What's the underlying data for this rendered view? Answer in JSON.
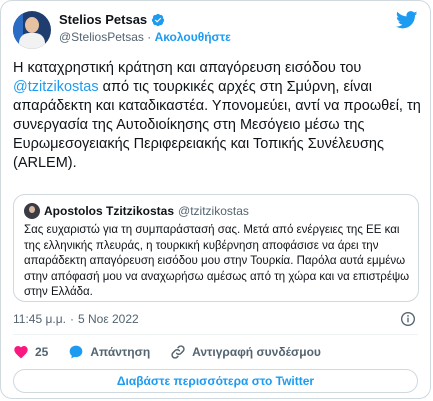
{
  "author": {
    "name": "Stelios Petsas",
    "handle": "@SteliosPetsas",
    "separator": "·",
    "follow_label": "Ακολουθήστε"
  },
  "tweet": {
    "text_before": "Η καταχρηστική κράτηση και απαγόρευση εισόδου του ",
    "mention": "@tzitzikostas",
    "text_after": " από τις τουρκικές αρχές στη Σμύρνη, είναι απαράδεκτη και καταδικαστέα. Υπονομεύει, αντί να προωθεί, τη συνεργασία της Αυτοδιοίκησης στη Μεσόγειο μέσω της Ευρωμεσογειακής Περιφερειακής και Τοπικής Συνέλευσης (ARLEM)."
  },
  "quote": {
    "name": "Apostolos Tzitzikostas",
    "handle": "@tzitzikostas",
    "text": "Σας ευχαριστώ για τη συμπαράστασή σας. Μετά από ενέργειες της ΕΕ και της ελληνικής πλευράς, η τουρκική κυβέρνηση αποφάσισε να άρει την απαράδεκτη απαγόρευση εισόδου μου στην Τουρκία. Παρόλα αυτά εμμένω στην απόφασή μου να αναχωρήσω αμέσως από τη χώρα και να επιστρέψω στην Ελλάδα."
  },
  "meta": {
    "time": "11:45 μ.μ.",
    "separator": "·",
    "date": "5 Νοε 2022"
  },
  "actions": {
    "like_count": "25",
    "reply_label": "Απάντηση",
    "copy_label": "Αντιγραφή συνδέσμου"
  },
  "more_button_label": "Διαβάστε περισσότερα στο Twitter",
  "colors": {
    "accent": "#1d9bf0",
    "like": "#f91880",
    "muted": "#536471",
    "border": "#cfd9de"
  },
  "icons": [
    "twitter-bird-icon",
    "verified-badge-icon",
    "info-icon",
    "heart-icon",
    "reply-bubble-icon",
    "link-icon"
  ]
}
